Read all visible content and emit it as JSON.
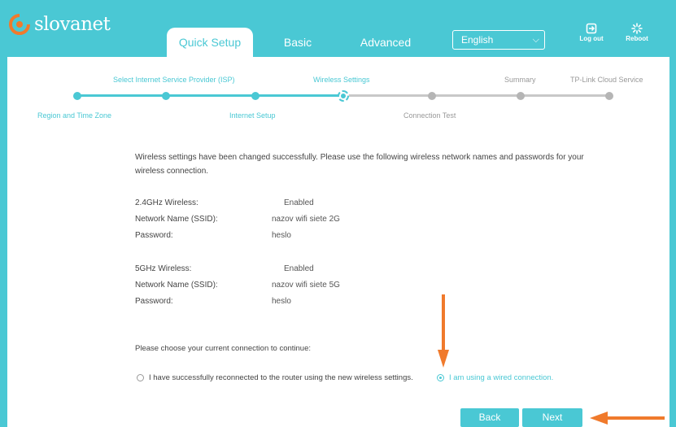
{
  "brand": {
    "name": "slovanet"
  },
  "nav": {
    "tabs": [
      {
        "label": "Quick Setup",
        "active": true
      },
      {
        "label": "Basic"
      },
      {
        "label": "Advanced"
      }
    ],
    "language": "English",
    "logout_label": "Log out",
    "reboot_label": "Reboot"
  },
  "steps": {
    "top": [
      "Select Internet Service Provider (ISP)",
      "Wireless Settings",
      "Summary",
      "TP-Link Cloud Service"
    ],
    "bottom": [
      "Region and Time Zone",
      "Internet Setup",
      "Connection Test"
    ],
    "current_step": 4,
    "total_steps": 7
  },
  "intro": {
    "line1": "Wireless settings have been changed successfully. Please use the following wireless network names and passwords for your",
    "line2": "wireless connection."
  },
  "band24": {
    "title_label": "2.4GHz Wireless:",
    "status": "Enabled",
    "ssid_label": "Network Name (SSID):",
    "ssid": "nazov wifi siete 2G",
    "password_label": "Password:",
    "password": "heslo"
  },
  "band5": {
    "title_label": "5GHz Wireless:",
    "status": "Enabled",
    "ssid_label": "Network Name (SSID):",
    "ssid": "nazov wifi siete 5G",
    "password_label": "Password:",
    "password": "heslo"
  },
  "choice": {
    "prompt": "Please choose your current connection to continue:",
    "option_wireless": "I have successfully reconnected to the router using the new wireless settings.",
    "option_wired": "I am using a wired connection.",
    "selected": "wired"
  },
  "buttons": {
    "back": "Back",
    "next": "Next"
  },
  "colors": {
    "accent": "#4ac8d4",
    "annotation_arrow": "#f07a2c",
    "inactive": "#999999"
  }
}
